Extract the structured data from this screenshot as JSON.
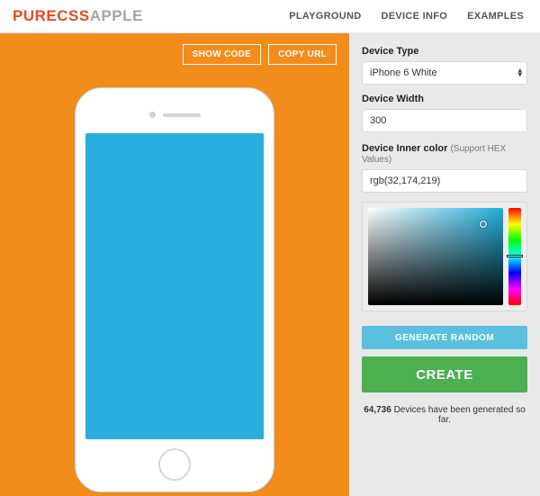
{
  "header": {
    "logo": {
      "part1": "PURECSS",
      "part2": "APPLE"
    },
    "nav": {
      "playground": "PLAYGROUND",
      "device_info": "DEVICE INFO",
      "examples": "EXAMPLES"
    }
  },
  "stage": {
    "show_code": "SHOW CODE",
    "copy_url": "COPY URL",
    "screen_color": "#2aaedf"
  },
  "panel": {
    "device_type_label": "Device Type",
    "device_type_value": "iPhone 6 White",
    "device_width_label": "Device Width",
    "device_width_value": "300",
    "inner_color_label": "Device Inner color",
    "inner_color_hint": "(Support HEX Values)",
    "inner_color_value": "rgb(32,174,219)",
    "generate_random": "GENERATE RANDOM",
    "create": "CREATE",
    "stats_count": "64,736",
    "stats_text": " Devices have been generated so far."
  }
}
